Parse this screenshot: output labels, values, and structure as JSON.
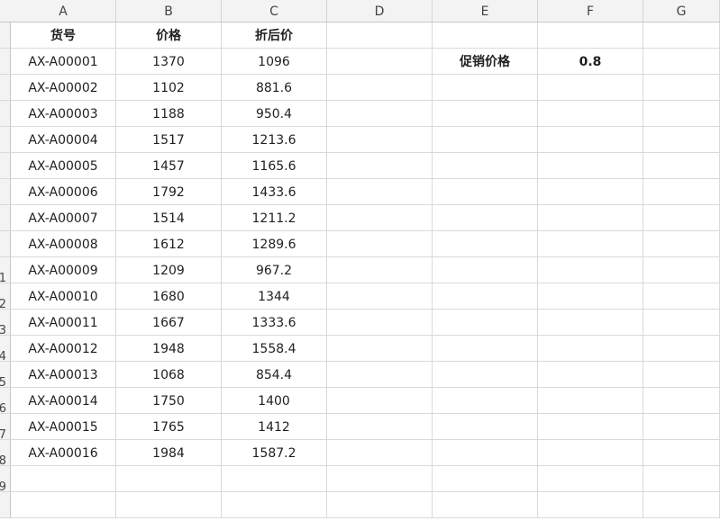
{
  "columns": [
    "A",
    "B",
    "C",
    "D",
    "E",
    "F",
    "G"
  ],
  "row_numbers": [
    "1",
    "2",
    "3",
    "4",
    "5",
    "6",
    "7",
    "8",
    "9",
    "10",
    "11",
    "12",
    "13",
    "14",
    "15",
    "16",
    "17",
    "18",
    "19"
  ],
  "row_number_partial": [
    "",
    "",
    "",
    "",
    "",
    "",
    "",
    "",
    "0",
    "1",
    "2",
    "3",
    "4",
    "5",
    "6",
    "7",
    "8",
    "9"
  ],
  "headers": {
    "A": "货号",
    "B": "价格",
    "C": "折后价"
  },
  "side": {
    "label": "促销价格",
    "value": "0.8"
  },
  "rows": [
    {
      "sku": "AX-A00001",
      "price": "1370",
      "discounted": "1096"
    },
    {
      "sku": "AX-A00002",
      "price": "1102",
      "discounted": "881.6"
    },
    {
      "sku": "AX-A00003",
      "price": "1188",
      "discounted": "950.4"
    },
    {
      "sku": "AX-A00004",
      "price": "1517",
      "discounted": "1213.6"
    },
    {
      "sku": "AX-A00005",
      "price": "1457",
      "discounted": "1165.6"
    },
    {
      "sku": "AX-A00006",
      "price": "1792",
      "discounted": "1433.6"
    },
    {
      "sku": "AX-A00007",
      "price": "1514",
      "discounted": "1211.2"
    },
    {
      "sku": "AX-A00008",
      "price": "1612",
      "discounted": "1289.6"
    },
    {
      "sku": "AX-A00009",
      "price": "1209",
      "discounted": "967.2"
    },
    {
      "sku": "AX-A00010",
      "price": "1680",
      "discounted": "1344"
    },
    {
      "sku": "AX-A00011",
      "price": "1667",
      "discounted": "1333.6"
    },
    {
      "sku": "AX-A00012",
      "price": "1948",
      "discounted": "1558.4"
    },
    {
      "sku": "AX-A00013",
      "price": "1068",
      "discounted": "854.4"
    },
    {
      "sku": "AX-A00014",
      "price": "1750",
      "discounted": "1400"
    },
    {
      "sku": "AX-A00015",
      "price": "1765",
      "discounted": "1412"
    },
    {
      "sku": "AX-A00016",
      "price": "1984",
      "discounted": "1587.2"
    }
  ],
  "colors": {
    "header_bg": "#f3f3f3",
    "gridline": "#d9d9d9",
    "selected_row_number": "#56b6c2"
  }
}
